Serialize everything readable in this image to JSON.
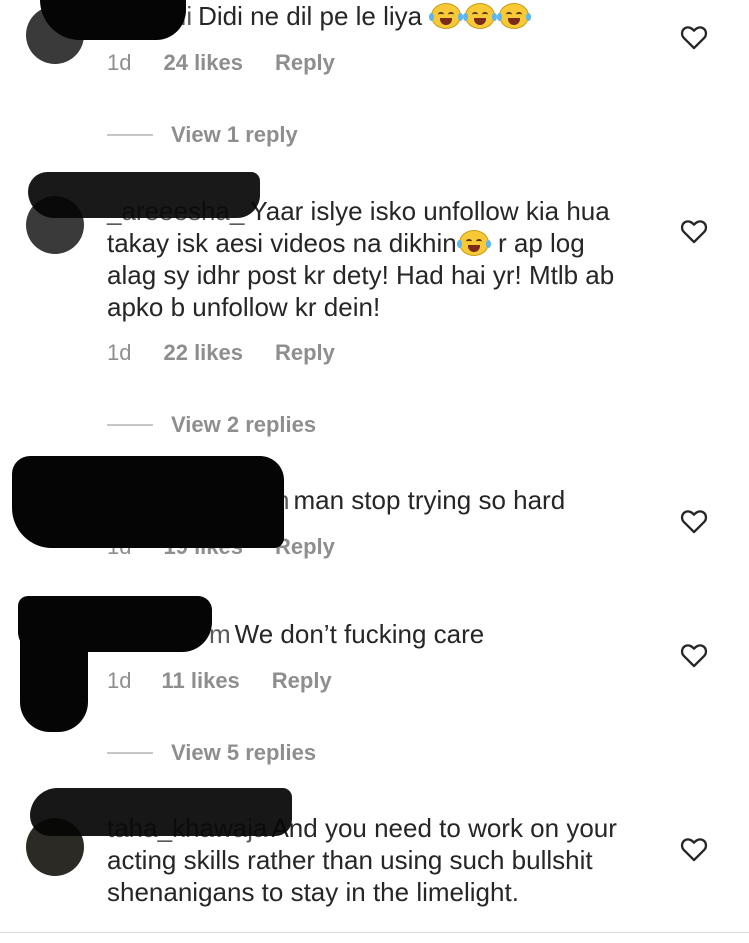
{
  "comments": [
    {
      "username": "iiii",
      "text": "Didi ne dil pe le liya",
      "emoji": "face-with-tears-of-joy",
      "time": "1d",
      "likes": "24 likes",
      "reply": "Reply",
      "view_replies": "View 1 reply"
    },
    {
      "username": "_areeesha_",
      "text_a": "Yaar islye isko unfollow kia hua takay isk aesi videos na dikhin",
      "text_b": "r ap log alag sy idhr post kr dety! Had hai yr! Mtlb ab apko b unfollow kr dein!",
      "emoji": "face-with-tears-of-joy",
      "time": "1d",
      "likes": "22 likes",
      "reply": "Reply",
      "view_replies": "View 2 replies"
    },
    {
      "username": "n",
      "text": "man stop trying so hard",
      "time": "1d",
      "likes": "19 likes",
      "reply": "Reply"
    },
    {
      "username": "m",
      "text": "We don’t fucking care",
      "time": "1d",
      "likes": "11 likes",
      "reply": "Reply",
      "view_replies": "View 5 replies"
    },
    {
      "username": "taha_khawaja",
      "text": "And you need to work on your acting skills rather than using such bullshit shenanigans to stay in the limelight."
    }
  ],
  "icons": {
    "like": "heart-outline-icon"
  },
  "colors": {
    "text": "#262626",
    "muted": "#8e8e8e",
    "redaction": "#050505"
  }
}
